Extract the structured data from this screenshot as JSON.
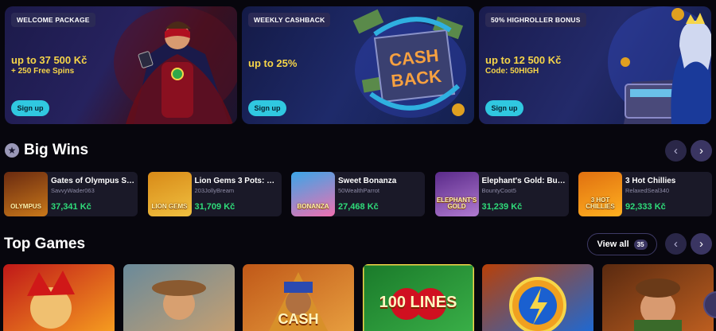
{
  "promos": [
    {
      "badge": "WELCOME PACKAGE",
      "headline": "up to 37 500 Kč",
      "sub": "+ 250 Free Spins",
      "cta": "Sign up"
    },
    {
      "badge": "WEEKLY CASHBACK",
      "headline": "up to 25%",
      "sub": "",
      "cta": "Sign up",
      "art_text_1": "CASH",
      "art_text_2": "BACK"
    },
    {
      "badge": "50% HIGHROLLER BONUS",
      "headline": "up to 12 500 Kč",
      "sub": "Code: 50HIGH",
      "cta": "Sign up"
    }
  ],
  "big_wins": {
    "title": "Big Wins",
    "items": [
      {
        "game": "Gates of Olympus Su...",
        "user": "SavvyWader063",
        "amount": "37,341 Kč",
        "thumb_text": "OLYMPUS",
        "colors": [
          "#6a2a10",
          "#c9781a"
        ]
      },
      {
        "game": "Lion Gems 3 Pots: H...",
        "user": "203JollyBream",
        "amount": "31,709 Kč",
        "thumb_text": "LION GEMS",
        "colors": [
          "#d88a18",
          "#f0c040"
        ]
      },
      {
        "game": "Sweet Bonanza",
        "user": "50WealthParrot",
        "amount": "27,468 Kč",
        "thumb_text": "BONANZA",
        "colors": [
          "#3aa6e8",
          "#f070b0"
        ]
      },
      {
        "game": "Elephant's Gold: Buy...",
        "user": "BountyCoot5",
        "amount": "31,239 Kč",
        "thumb_text": "ELEPHANT'S GOLD",
        "colors": [
          "#5a2a8a",
          "#b07ad0"
        ]
      },
      {
        "game": "3 Hot Chillies",
        "user": "RelaxedSeal340",
        "amount": "92,333 Kč",
        "thumb_text": "3 HOT CHILLIES",
        "colors": [
          "#e07010",
          "#ffb020"
        ]
      }
    ]
  },
  "top_games": {
    "title": "Top Games",
    "view_all": "View all",
    "count": "35",
    "items": [
      {
        "name": "jester",
        "art_text": "",
        "colors": [
          "#c01818",
          "#f7a020"
        ]
      },
      {
        "name": "cowboy",
        "art_text": "",
        "colors": [
          "#6a8a9a",
          "#c8a070"
        ]
      },
      {
        "name": "cleopatra",
        "art_text": "CASH",
        "colors": [
          "#c05818",
          "#e8a040"
        ]
      },
      {
        "name": "cherry",
        "art_text": "100 LINES",
        "colors": [
          "#1a7a2a",
          "#3ab048"
        ]
      },
      {
        "name": "lightning",
        "art_text": "",
        "colors": [
          "#b84008",
          "#1a6ad8"
        ]
      },
      {
        "name": "explorer",
        "art_text": "",
        "colors": [
          "#5a2a10",
          "#c06020"
        ]
      }
    ]
  },
  "accent": "#30c8e0",
  "win_color": "#2fdc7a",
  "highlight_color": "#f6d548"
}
